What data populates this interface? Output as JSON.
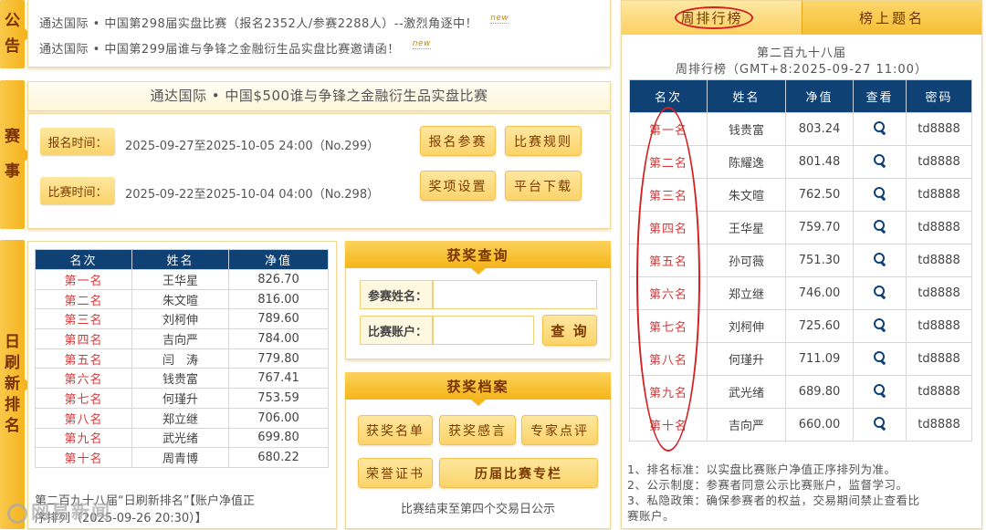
{
  "notice": {
    "tab_label": "公\n告",
    "lines": [
      {
        "text": "通达国际 • 中国第298届实盘比赛（报名2352人/参赛2288人）--激烈角逐中！",
        "tag": "new"
      },
      {
        "text": "通达国际 • 中国第299届谁与争锋之金融衍生品实盘比赛邀请函！",
        "tag": "new"
      }
    ]
  },
  "contest": {
    "tab_label": "赛\n事",
    "title": "通达国际 • 中国$500谁与争锋之金融衍生品实盘比赛",
    "signup_label": "报名时间：",
    "signup_value": "2025-09-27至2025-10-05 24:00（No.299）",
    "match_label": "比赛时间：",
    "match_value": "2025-09-22至2025-10-04 04:00（No.298）",
    "buttons": {
      "signup": "报名参赛",
      "rules": "比赛规则",
      "prizes": "奖项设置",
      "download": "平台下载"
    }
  },
  "daily": {
    "tab_label": "日\n刷\n新\n排\n名",
    "columns": [
      "名次",
      "姓名",
      "净值"
    ],
    "rows": [
      [
        "第一名",
        "王华星",
        "826.70"
      ],
      [
        "第二名",
        "朱文暄",
        "816.00"
      ],
      [
        "第三名",
        "刘柯伸",
        "789.60"
      ],
      [
        "第四名",
        "吉向严",
        "784.00"
      ],
      [
        "第五名",
        "闫　涛",
        "779.80"
      ],
      [
        "第六名",
        "钱贵富",
        "767.41"
      ],
      [
        "第七名",
        "何瑾升",
        "753.59"
      ],
      [
        "第八名",
        "郑立继",
        "706.00"
      ],
      [
        "第九名",
        "武光绪",
        "699.80"
      ],
      [
        "第十名",
        "周青博",
        "680.22"
      ]
    ],
    "footer_line1": "第二百九十八届“日刷新排名”【账户净值正",
    "footer_line2": "序排列（2025-09-26 20:30）】",
    "watermark": "网易新闻"
  },
  "prize_query": {
    "title": "获奖查询",
    "name_label": "参赛姓名：",
    "name_value": "",
    "account_label": "比赛账户：",
    "account_value": "",
    "query_button": "查 询"
  },
  "prize_archive": {
    "title": "获奖档案",
    "buttons": {
      "winners": "获奖名单",
      "speeches": "获奖感言",
      "reviews": "专家点评",
      "certificate": "荣誉证书",
      "history": "历届比赛专栏"
    },
    "note": "比赛结束至第四个交易日公示"
  },
  "weekly": {
    "tab_active": "周排行榜",
    "tab_other": "榜上题名",
    "heading1": "第二百九十八届",
    "heading2": "周排行榜（GMT+8:2025-09-27 11:00）",
    "columns": [
      "名次",
      "姓名",
      "净值",
      "查看",
      "密码"
    ],
    "rows": [
      [
        "第一名",
        "钱贵富",
        "803.24",
        "td8888"
      ],
      [
        "第二名",
        "陈耀逸",
        "801.48",
        "td8888"
      ],
      [
        "第三名",
        "朱文暄",
        "762.50",
        "td8888"
      ],
      [
        "第四名",
        "王华星",
        "759.70",
        "td8888"
      ],
      [
        "第五名",
        "孙可薇",
        "751.30",
        "td8888"
      ],
      [
        "第六名",
        "郑立继",
        "746.00",
        "td8888"
      ],
      [
        "第七名",
        "刘柯伸",
        "725.60",
        "td8888"
      ],
      [
        "第八名",
        "何瑾升",
        "711.09",
        "td8888"
      ],
      [
        "第九名",
        "武光绪",
        "689.80",
        "td8888"
      ],
      [
        "第十名",
        "吉向严",
        "660.00",
        "td8888"
      ]
    ],
    "view_icon": "search-icon",
    "notes": [
      "1、排名标准：以实盘比赛账户净值正序排列为准。",
      "2、公示制度：参赛者同意公示比赛账户，监督学习。",
      "3、私隐政策：确保参赛者的权益，交易期间禁止查看比",
      "赛账户。"
    ]
  },
  "colors": {
    "accent": "#f6b41f",
    "table_header": "#0f4175",
    "rank_red": "#d53a3a",
    "annotation_red": "#d42020"
  }
}
